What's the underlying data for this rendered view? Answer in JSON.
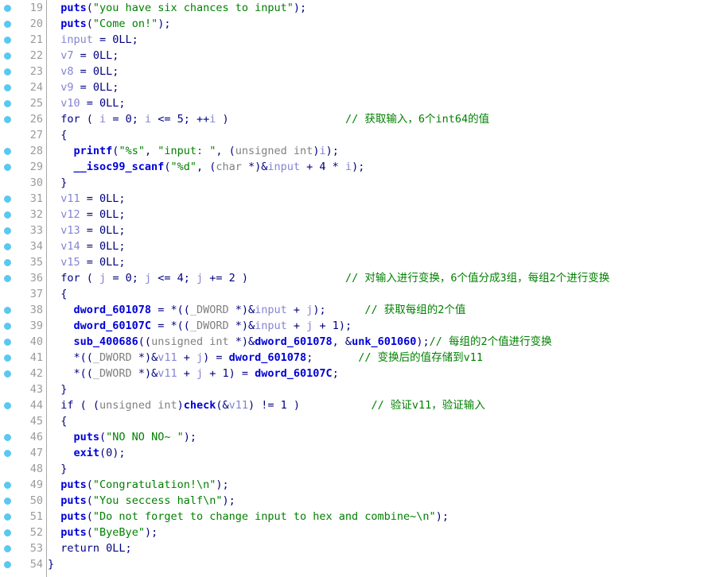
{
  "view": {
    "name": "hex-rays-pseudocode",
    "gutter_dot_color": "#5ac8f0",
    "line_number_color": "#9a9a9a",
    "background": "#ffffff",
    "colors": {
      "function": "#0000d8",
      "string": "#008000",
      "comment": "#008000",
      "local_variable": "#8484d4",
      "type": "#808080",
      "punctuation": "#000080"
    }
  },
  "lines": [
    {
      "num": "19",
      "bp": true,
      "tokens": [
        {
          "c": "plain",
          "t": "  "
        },
        {
          "c": "fn",
          "t": "puts"
        },
        {
          "c": "plain",
          "t": "("
        },
        {
          "c": "str",
          "t": "\"you have six chances to input\""
        },
        {
          "c": "plain",
          "t": ");"
        }
      ]
    },
    {
      "num": "20",
      "bp": true,
      "tokens": [
        {
          "c": "plain",
          "t": "  "
        },
        {
          "c": "fn",
          "t": "puts"
        },
        {
          "c": "plain",
          "t": "("
        },
        {
          "c": "str",
          "t": "\"Come on!\""
        },
        {
          "c": "plain",
          "t": ");"
        }
      ]
    },
    {
      "num": "21",
      "bp": true,
      "tokens": [
        {
          "c": "plain",
          "t": "  "
        },
        {
          "c": "var",
          "t": "input"
        },
        {
          "c": "plain",
          "t": " = 0LL;"
        }
      ]
    },
    {
      "num": "22",
      "bp": true,
      "tokens": [
        {
          "c": "plain",
          "t": "  "
        },
        {
          "c": "var",
          "t": "v7"
        },
        {
          "c": "plain",
          "t": " = 0LL;"
        }
      ]
    },
    {
      "num": "23",
      "bp": true,
      "tokens": [
        {
          "c": "plain",
          "t": "  "
        },
        {
          "c": "var",
          "t": "v8"
        },
        {
          "c": "plain",
          "t": " = 0LL;"
        }
      ]
    },
    {
      "num": "24",
      "bp": true,
      "tokens": [
        {
          "c": "plain",
          "t": "  "
        },
        {
          "c": "var",
          "t": "v9"
        },
        {
          "c": "plain",
          "t": " = 0LL;"
        }
      ]
    },
    {
      "num": "25",
      "bp": true,
      "tokens": [
        {
          "c": "plain",
          "t": "  "
        },
        {
          "c": "var",
          "t": "v10"
        },
        {
          "c": "plain",
          "t": " = 0LL;"
        }
      ]
    },
    {
      "num": "26",
      "bp": true,
      "tokens": [
        {
          "c": "plain",
          "t": "  "
        },
        {
          "c": "kw",
          "t": "for"
        },
        {
          "c": "plain",
          "t": " ( "
        },
        {
          "c": "var",
          "t": "i"
        },
        {
          "c": "plain",
          "t": " = 0; "
        },
        {
          "c": "var",
          "t": "i"
        },
        {
          "c": "plain",
          "t": " <= 5; ++"
        },
        {
          "c": "var",
          "t": "i"
        },
        {
          "c": "plain",
          "t": " )"
        },
        {
          "c": "plain",
          "t": "                  "
        },
        {
          "c": "cmt",
          "t": "// 获取输入，6个int64的值"
        }
      ]
    },
    {
      "num": "27",
      "bp": false,
      "tokens": [
        {
          "c": "plain",
          "t": "  {"
        }
      ]
    },
    {
      "num": "28",
      "bp": true,
      "tokens": [
        {
          "c": "plain",
          "t": "    "
        },
        {
          "c": "fn",
          "t": "printf"
        },
        {
          "c": "plain",
          "t": "("
        },
        {
          "c": "str",
          "t": "\"%s\""
        },
        {
          "c": "plain",
          "t": ", "
        },
        {
          "c": "str",
          "t": "\"input: \""
        },
        {
          "c": "plain",
          "t": ", ("
        },
        {
          "c": "type",
          "t": "unsigned int"
        },
        {
          "c": "plain",
          "t": ")"
        },
        {
          "c": "var",
          "t": "i"
        },
        {
          "c": "plain",
          "t": ");"
        }
      ]
    },
    {
      "num": "29",
      "bp": true,
      "tokens": [
        {
          "c": "plain",
          "t": "    "
        },
        {
          "c": "fn",
          "t": "__isoc99_scanf"
        },
        {
          "c": "plain",
          "t": "("
        },
        {
          "c": "str",
          "t": "\"%d\""
        },
        {
          "c": "plain",
          "t": ", ("
        },
        {
          "c": "type",
          "t": "char"
        },
        {
          "c": "plain",
          "t": " *)&"
        },
        {
          "c": "var",
          "t": "input"
        },
        {
          "c": "plain",
          "t": " + 4 * "
        },
        {
          "c": "var",
          "t": "i"
        },
        {
          "c": "plain",
          "t": ");"
        }
      ]
    },
    {
      "num": "30",
      "bp": false,
      "tokens": [
        {
          "c": "plain",
          "t": "  }"
        }
      ]
    },
    {
      "num": "31",
      "bp": true,
      "tokens": [
        {
          "c": "plain",
          "t": "  "
        },
        {
          "c": "var",
          "t": "v11"
        },
        {
          "c": "plain",
          "t": " = 0LL;"
        }
      ]
    },
    {
      "num": "32",
      "bp": true,
      "tokens": [
        {
          "c": "plain",
          "t": "  "
        },
        {
          "c": "var",
          "t": "v12"
        },
        {
          "c": "plain",
          "t": " = 0LL;"
        }
      ]
    },
    {
      "num": "33",
      "bp": true,
      "tokens": [
        {
          "c": "plain",
          "t": "  "
        },
        {
          "c": "var",
          "t": "v13"
        },
        {
          "c": "plain",
          "t": " = 0LL;"
        }
      ]
    },
    {
      "num": "34",
      "bp": true,
      "tokens": [
        {
          "c": "plain",
          "t": "  "
        },
        {
          "c": "var",
          "t": "v14"
        },
        {
          "c": "plain",
          "t": " = 0LL;"
        }
      ]
    },
    {
      "num": "35",
      "bp": true,
      "tokens": [
        {
          "c": "plain",
          "t": "  "
        },
        {
          "c": "var",
          "t": "v15"
        },
        {
          "c": "plain",
          "t": " = 0LL;"
        }
      ]
    },
    {
      "num": "36",
      "bp": true,
      "tokens": [
        {
          "c": "plain",
          "t": "  "
        },
        {
          "c": "kw",
          "t": "for"
        },
        {
          "c": "plain",
          "t": " ( "
        },
        {
          "c": "var",
          "t": "j"
        },
        {
          "c": "plain",
          "t": " = 0; "
        },
        {
          "c": "var",
          "t": "j"
        },
        {
          "c": "plain",
          "t": " <= 4; "
        },
        {
          "c": "var",
          "t": "j"
        },
        {
          "c": "plain",
          "t": " += 2 )"
        },
        {
          "c": "plain",
          "t": "               "
        },
        {
          "c": "cmt",
          "t": "// 对输入进行变换，6个值分成3组，每组2个进行变换"
        }
      ]
    },
    {
      "num": "37",
      "bp": false,
      "tokens": [
        {
          "c": "plain",
          "t": "  {"
        }
      ]
    },
    {
      "num": "38",
      "bp": true,
      "tokens": [
        {
          "c": "plain",
          "t": "    "
        },
        {
          "c": "fn",
          "t": "dword_601078"
        },
        {
          "c": "plain",
          "t": " = *(("
        },
        {
          "c": "type",
          "t": "_DWORD"
        },
        {
          "c": "plain",
          "t": " *)&"
        },
        {
          "c": "var",
          "t": "input"
        },
        {
          "c": "plain",
          "t": " + "
        },
        {
          "c": "var",
          "t": "j"
        },
        {
          "c": "plain",
          "t": ");"
        },
        {
          "c": "plain",
          "t": "      "
        },
        {
          "c": "cmt",
          "t": "// 获取每组的2个值"
        }
      ]
    },
    {
      "num": "39",
      "bp": true,
      "tokens": [
        {
          "c": "plain",
          "t": "    "
        },
        {
          "c": "fn",
          "t": "dword_60107C"
        },
        {
          "c": "plain",
          "t": " = *(("
        },
        {
          "c": "type",
          "t": "_DWORD"
        },
        {
          "c": "plain",
          "t": " *)&"
        },
        {
          "c": "var",
          "t": "input"
        },
        {
          "c": "plain",
          "t": " + "
        },
        {
          "c": "var",
          "t": "j"
        },
        {
          "c": "plain",
          "t": " + 1);"
        }
      ]
    },
    {
      "num": "40",
      "bp": true,
      "tokens": [
        {
          "c": "plain",
          "t": "    "
        },
        {
          "c": "fn",
          "t": "sub_400686"
        },
        {
          "c": "plain",
          "t": "(("
        },
        {
          "c": "type",
          "t": "unsigned int"
        },
        {
          "c": "plain",
          "t": " *)&"
        },
        {
          "c": "fn",
          "t": "dword_601078"
        },
        {
          "c": "plain",
          "t": ", &"
        },
        {
          "c": "fn",
          "t": "unk_601060"
        },
        {
          "c": "plain",
          "t": ");"
        },
        {
          "c": "cmt",
          "t": "// 每组的2个值进行变换"
        }
      ]
    },
    {
      "num": "41",
      "bp": true,
      "tokens": [
        {
          "c": "plain",
          "t": "    *(("
        },
        {
          "c": "type",
          "t": "_DWORD"
        },
        {
          "c": "plain",
          "t": " *)&"
        },
        {
          "c": "var",
          "t": "v11"
        },
        {
          "c": "plain",
          "t": " + "
        },
        {
          "c": "var",
          "t": "j"
        },
        {
          "c": "plain",
          "t": ") = "
        },
        {
          "c": "fn",
          "t": "dword_601078"
        },
        {
          "c": "plain",
          "t": ";"
        },
        {
          "c": "plain",
          "t": "       "
        },
        {
          "c": "cmt",
          "t": "// 变换后的值存储到v11"
        }
      ]
    },
    {
      "num": "42",
      "bp": true,
      "tokens": [
        {
          "c": "plain",
          "t": "    *(("
        },
        {
          "c": "type",
          "t": "_DWORD"
        },
        {
          "c": "plain",
          "t": " *)&"
        },
        {
          "c": "var",
          "t": "v11"
        },
        {
          "c": "plain",
          "t": " + "
        },
        {
          "c": "var",
          "t": "j"
        },
        {
          "c": "plain",
          "t": " + 1) = "
        },
        {
          "c": "fn",
          "t": "dword_60107C"
        },
        {
          "c": "plain",
          "t": ";"
        }
      ]
    },
    {
      "num": "43",
      "bp": false,
      "tokens": [
        {
          "c": "plain",
          "t": "  }"
        }
      ]
    },
    {
      "num": "44",
      "bp": true,
      "tokens": [
        {
          "c": "plain",
          "t": "  "
        },
        {
          "c": "kw",
          "t": "if"
        },
        {
          "c": "plain",
          "t": " ( ("
        },
        {
          "c": "type",
          "t": "unsigned int"
        },
        {
          "c": "plain",
          "t": ")"
        },
        {
          "c": "fn",
          "t": "check"
        },
        {
          "c": "plain",
          "t": "(&"
        },
        {
          "c": "var",
          "t": "v11"
        },
        {
          "c": "plain",
          "t": ") != 1 )"
        },
        {
          "c": "plain",
          "t": "           "
        },
        {
          "c": "cmt",
          "t": "// 验证v11，验证输入"
        }
      ]
    },
    {
      "num": "45",
      "bp": false,
      "tokens": [
        {
          "c": "plain",
          "t": "  {"
        }
      ]
    },
    {
      "num": "46",
      "bp": true,
      "tokens": [
        {
          "c": "plain",
          "t": "    "
        },
        {
          "c": "fn",
          "t": "puts"
        },
        {
          "c": "plain",
          "t": "("
        },
        {
          "c": "str",
          "t": "\"NO NO NO~ \""
        },
        {
          "c": "plain",
          "t": ");"
        }
      ]
    },
    {
      "num": "47",
      "bp": true,
      "tokens": [
        {
          "c": "plain",
          "t": "    "
        },
        {
          "c": "fn",
          "t": "exit"
        },
        {
          "c": "plain",
          "t": "(0);"
        }
      ]
    },
    {
      "num": "48",
      "bp": false,
      "tokens": [
        {
          "c": "plain",
          "t": "  }"
        }
      ]
    },
    {
      "num": "49",
      "bp": true,
      "tokens": [
        {
          "c": "plain",
          "t": "  "
        },
        {
          "c": "fn",
          "t": "puts"
        },
        {
          "c": "plain",
          "t": "("
        },
        {
          "c": "str",
          "t": "\"Congratulation!\\n\""
        },
        {
          "c": "plain",
          "t": ");"
        }
      ]
    },
    {
      "num": "50",
      "bp": true,
      "tokens": [
        {
          "c": "plain",
          "t": "  "
        },
        {
          "c": "fn",
          "t": "puts"
        },
        {
          "c": "plain",
          "t": "("
        },
        {
          "c": "str",
          "t": "\"You seccess half\\n\""
        },
        {
          "c": "plain",
          "t": ");"
        }
      ]
    },
    {
      "num": "51",
      "bp": true,
      "tokens": [
        {
          "c": "plain",
          "t": "  "
        },
        {
          "c": "fn",
          "t": "puts"
        },
        {
          "c": "plain",
          "t": "("
        },
        {
          "c": "str",
          "t": "\"Do not forget to change input to hex and combine~\\n\""
        },
        {
          "c": "plain",
          "t": ");"
        }
      ]
    },
    {
      "num": "52",
      "bp": true,
      "tokens": [
        {
          "c": "plain",
          "t": "  "
        },
        {
          "c": "fn",
          "t": "puts"
        },
        {
          "c": "plain",
          "t": "("
        },
        {
          "c": "str",
          "t": "\"ByeBye\""
        },
        {
          "c": "plain",
          "t": ");"
        }
      ]
    },
    {
      "num": "53",
      "bp": true,
      "tokens": [
        {
          "c": "plain",
          "t": "  "
        },
        {
          "c": "kw",
          "t": "return"
        },
        {
          "c": "plain",
          "t": " 0LL;"
        }
      ]
    },
    {
      "num": "54",
      "bp": true,
      "tokens": [
        {
          "c": "plain",
          "t": "}"
        }
      ]
    }
  ]
}
